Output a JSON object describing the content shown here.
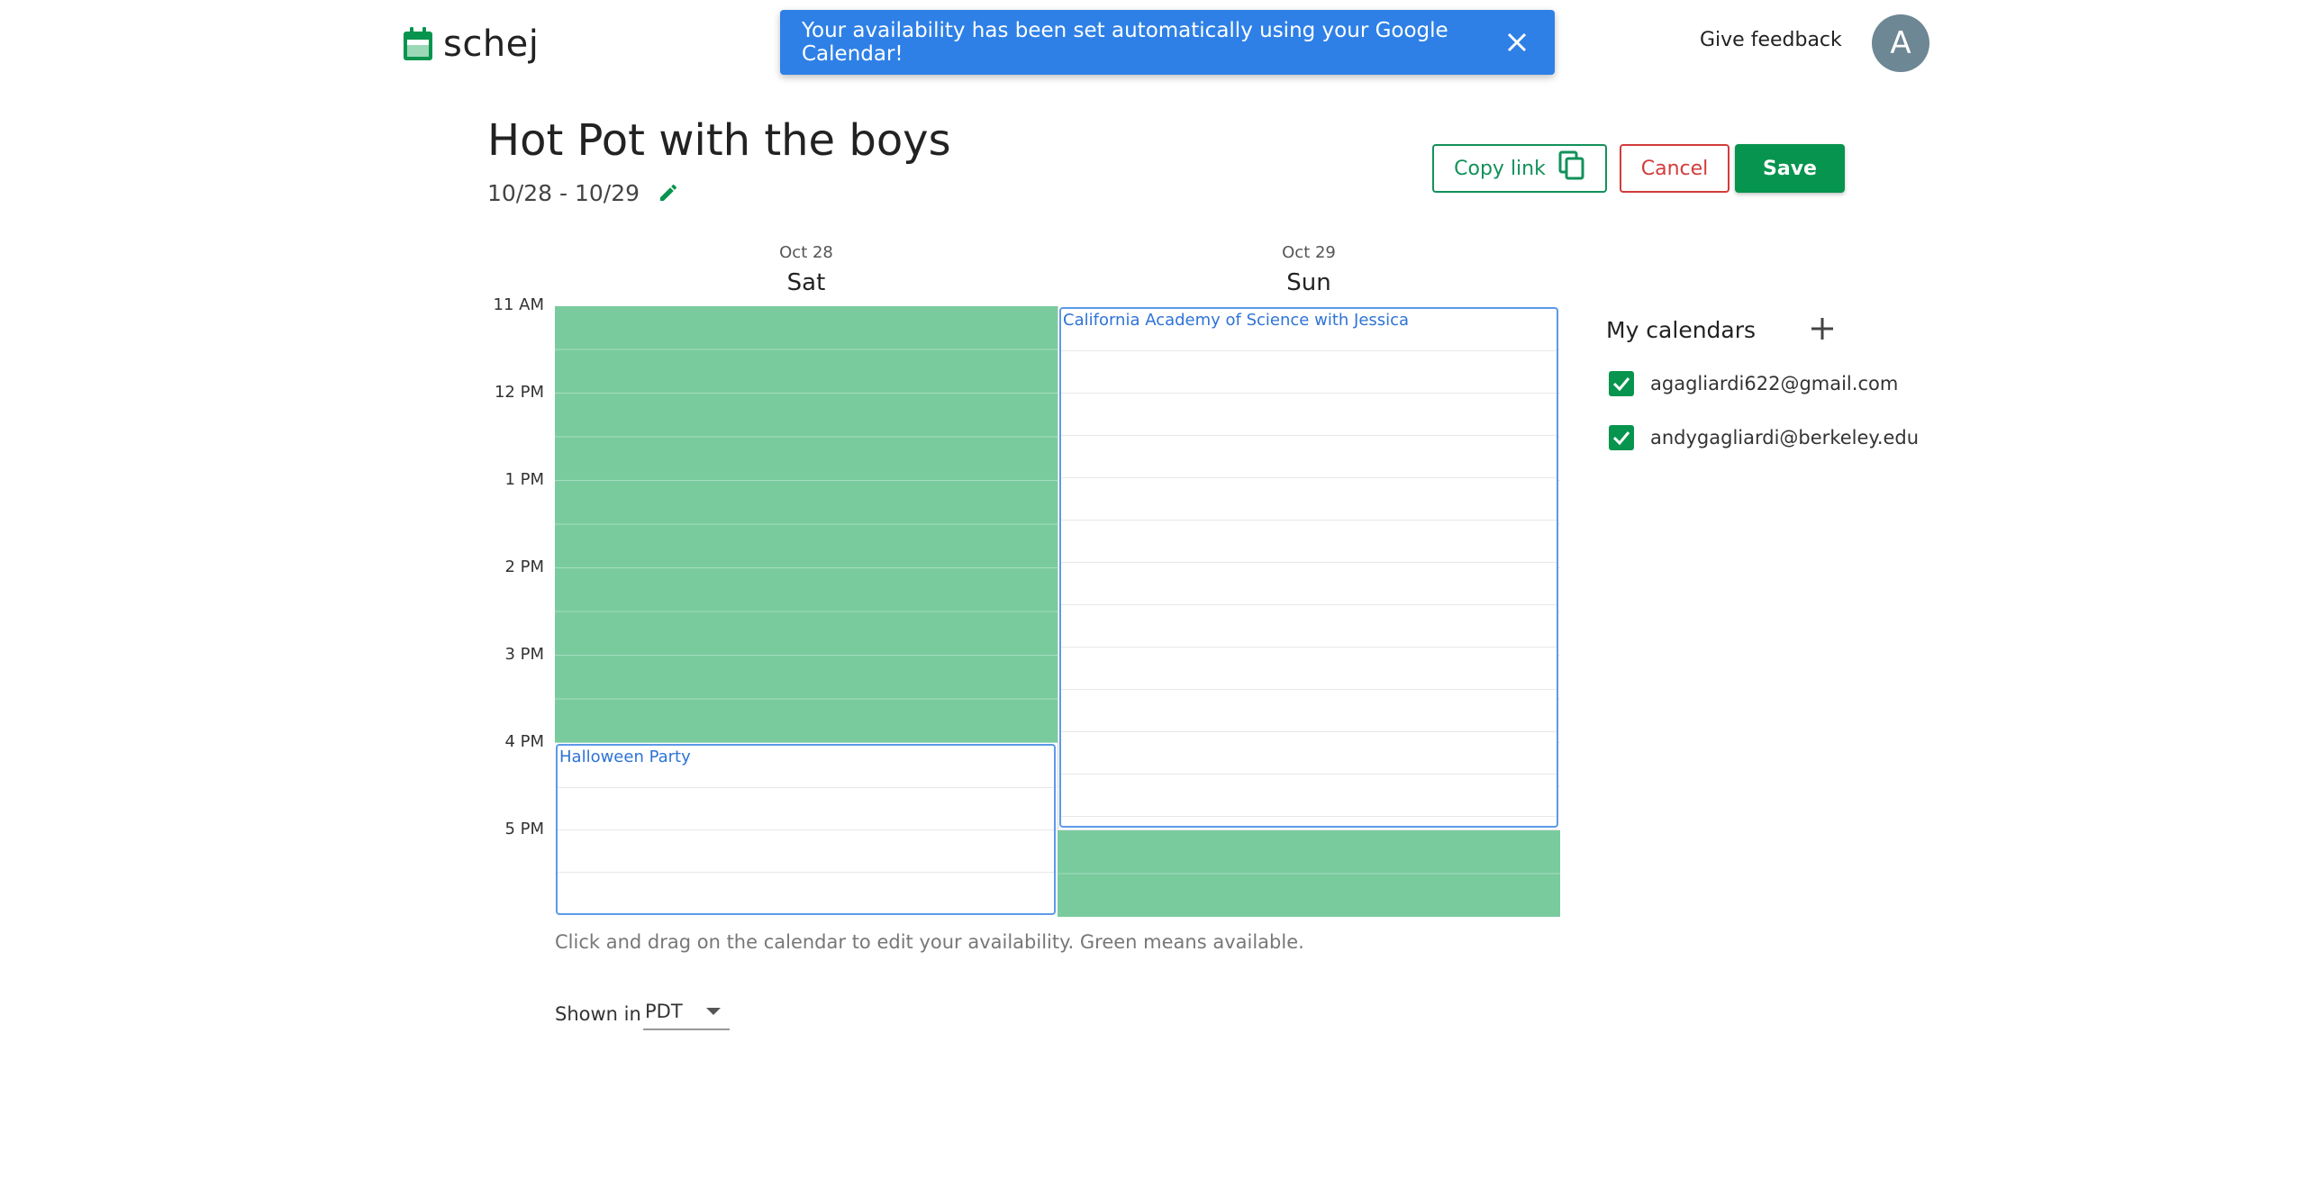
{
  "header": {
    "logo_text": "schej",
    "toast_message": "Your availability has been set automatically using your Google Calendar!",
    "feedback_label": "Give feedback",
    "avatar_initial": "A",
    "colors": {
      "brand_green": "#07944e",
      "toast_blue": "#2e80e6"
    }
  },
  "event": {
    "title": "Hot Pot with the boys",
    "date_range": "10/28 - 10/29"
  },
  "actions": {
    "copy_link_label": "Copy link",
    "cancel_label": "Cancel",
    "save_label": "Save"
  },
  "calendar": {
    "days": [
      {
        "date": "Oct 28",
        "name": "Sat"
      },
      {
        "date": "Oct 29",
        "name": "Sun"
      }
    ],
    "times": [
      "11 AM",
      "12 PM",
      "1 PM",
      "2 PM",
      "3 PM",
      "4 PM",
      "5 PM"
    ],
    "events": [
      {
        "day": "Sat",
        "title": "Halloween Party",
        "start": "4 PM",
        "end": "6 PM"
      },
      {
        "day": "Sun",
        "title": "California Academy of Science with Jessica",
        "start": "11 AM",
        "end": "5 PM"
      }
    ],
    "availability": [
      {
        "day": "Sat",
        "start": "11 AM",
        "end": "4 PM"
      },
      {
        "day": "Sun",
        "start": "5 PM",
        "end": "6 PM"
      }
    ],
    "hint": "Click and drag on the calendar to edit your availability. Green means available.",
    "timezone_label": "Shown in",
    "timezone_value": "PDT"
  },
  "sidebar": {
    "title": "My calendars",
    "calendars": [
      {
        "email": "agagliardi622@gmail.com",
        "checked": true
      },
      {
        "email": "andygagliardi@berkeley.edu",
        "checked": true
      }
    ]
  }
}
